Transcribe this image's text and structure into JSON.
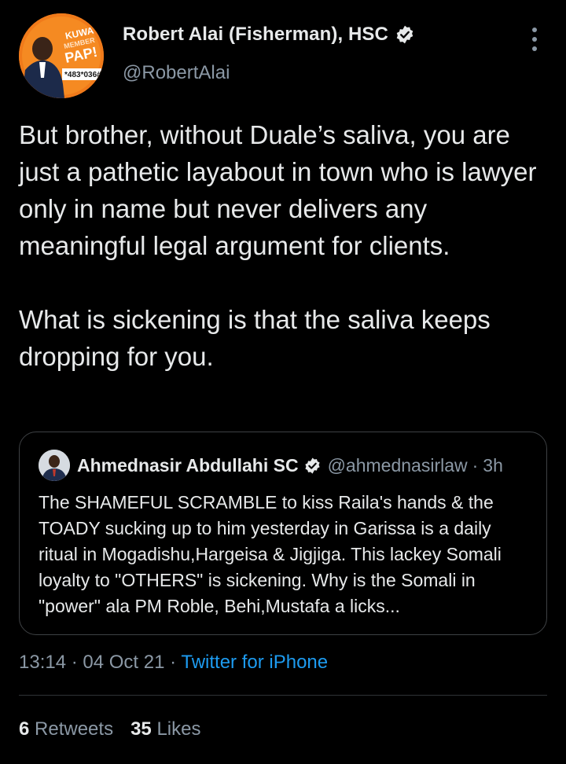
{
  "author": {
    "display_name": "Robert Alai (Fisherman), HSC",
    "handle": "@RobertAlai",
    "avatar_text": [
      "KUWA",
      "MEMBER",
      "PAP!",
      "*483*036#"
    ]
  },
  "tweet": {
    "paragraphs": [
      "But brother, without Duale’s saliva, you are just a pathetic layabout in town who is lawyer only in name but never delivers any meaningful legal argument for clients.",
      "What is sickening is that the saliva keeps dropping for you."
    ]
  },
  "quoted_tweet": {
    "display_name": "Ahmednasir Abdullahi SC",
    "handle": "@ahmednasirlaw",
    "separator": "·",
    "time": "3h",
    "text": "The SHAMEFUL SCRAMBLE to kiss Raila's hands & the TOADY sucking up to him yesterday in Garissa is a daily ritual in Mogadishu,Hargeisa & Jigjiga. This lackey Somali loyalty to \"OTHERS\" is sickening. Why is the Somali in \"power\" ala PM Roble, Behi,Mustafa a licks..."
  },
  "meta": {
    "time": "13:14",
    "sep1": " · ",
    "date": "04 Oct 21",
    "sep2": " · ",
    "source": "Twitter for iPhone"
  },
  "stats": {
    "retweets_count": "6",
    "retweets_label": "Retweets",
    "likes_count": "35",
    "likes_label": "Likes"
  },
  "colors": {
    "background": "#000000",
    "text": "#e7e9ea",
    "muted": "#8b98a5",
    "link": "#1d9bf0",
    "avatar_bg": "#f07a1a"
  },
  "icons": {
    "verified": "verified-badge-icon",
    "more": "more-options-icon"
  }
}
